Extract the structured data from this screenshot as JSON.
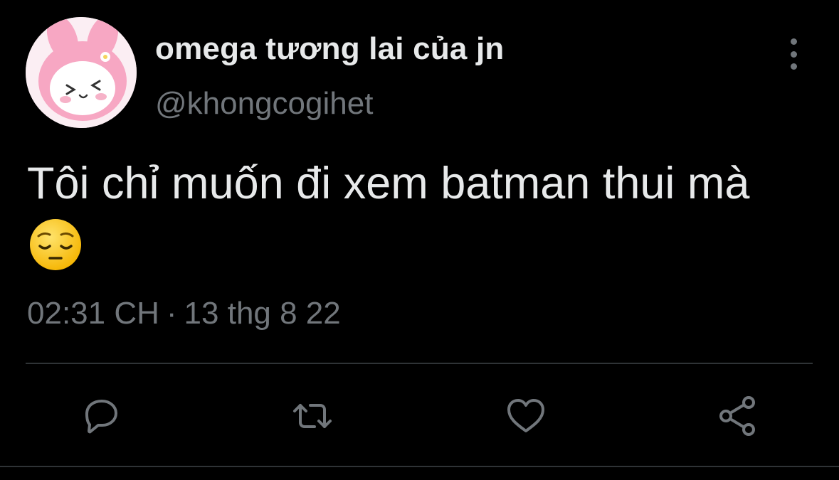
{
  "author": {
    "display_name": "omega tương lai của jn",
    "handle": "@khongcogihet",
    "avatar_icon": "pink-bunny-character-avatar"
  },
  "tweet": {
    "text": "Tôi chỉ muốn đi xem batman thui mà",
    "emoji": "pensive-face-emoji",
    "time": "02:31 CH",
    "separator": "·",
    "date": "13 thg 8 22"
  },
  "header": {
    "more_icon": "more-vertical-icon"
  },
  "actions": [
    {
      "name": "reply",
      "icon": "reply-icon"
    },
    {
      "name": "retweet",
      "icon": "retweet-icon"
    },
    {
      "name": "like",
      "icon": "heart-icon"
    },
    {
      "name": "share",
      "icon": "share-icon"
    }
  ],
  "colors": {
    "background": "#000000",
    "primary_text": "#e7e9ea",
    "secondary_text": "#71767b",
    "divider": "#2f3336"
  }
}
